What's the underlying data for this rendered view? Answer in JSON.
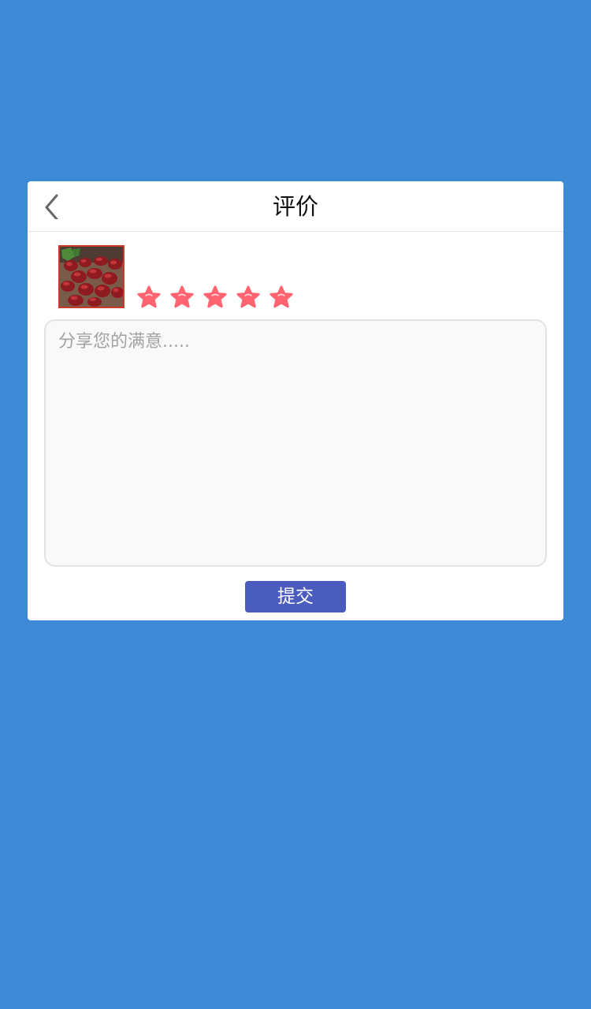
{
  "dialog": {
    "title": "评价",
    "back_icon": "chevron-left-icon"
  },
  "product": {
    "thumbnail": "red-dates-photo"
  },
  "rating": {
    "value": 5,
    "max": 5,
    "icon": "star-icon",
    "color": "#ff6470"
  },
  "review": {
    "value": "",
    "placeholder": "分享您的满意....."
  },
  "actions": {
    "submit_label": "提交"
  },
  "colors": {
    "background": "#3e8ad6",
    "card": "#ffffff",
    "submit_button": "#4b5cbf",
    "thumbnail_border": "#c83a2c"
  }
}
